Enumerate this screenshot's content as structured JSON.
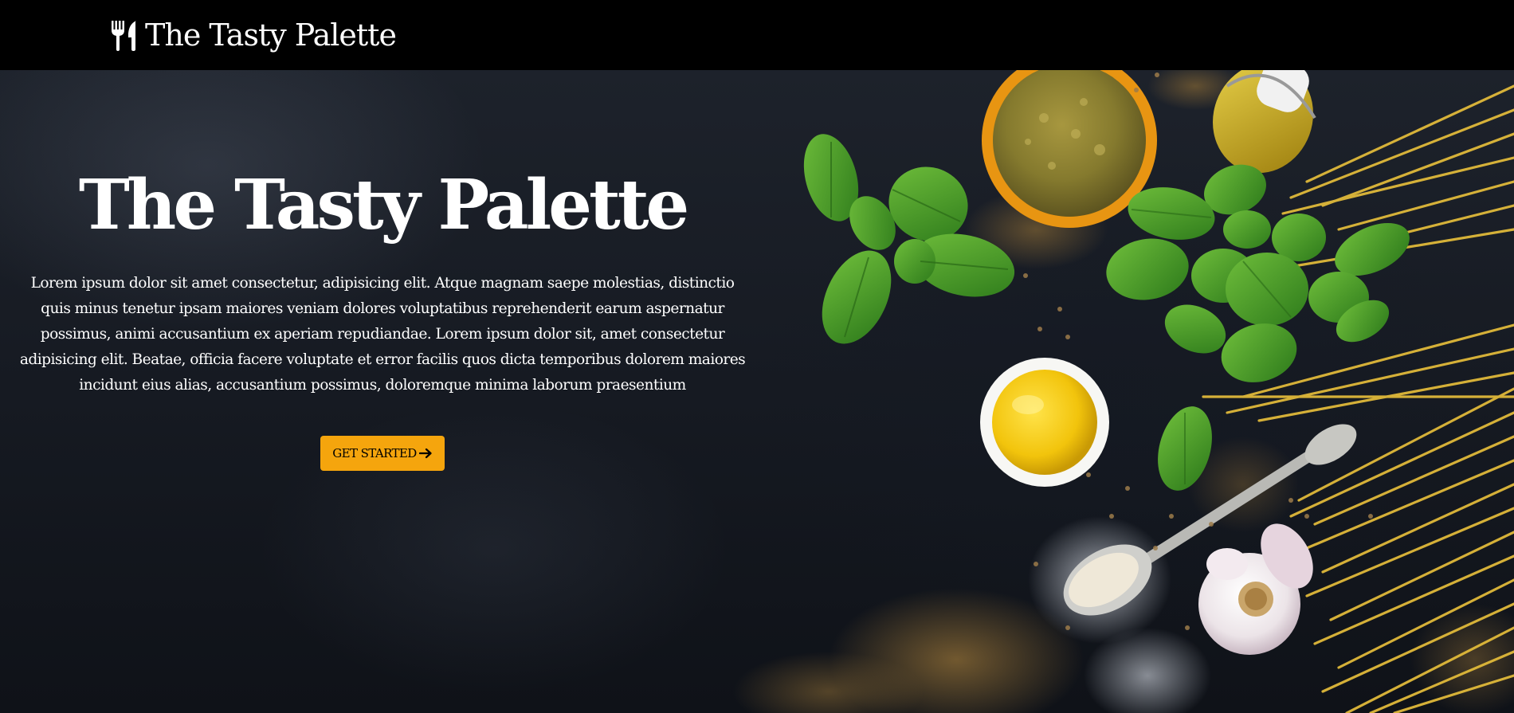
{
  "navbar": {
    "brand_icon": "utensils-icon",
    "brand_name": "The Tasty Palette"
  },
  "hero": {
    "title": "The Tasty Palette",
    "text": "Lorem ipsum dolor sit amet consectetur, adipisicing elit. Atque magnam saepe molestias, distinctio quis minus tenetur ipsam maiores veniam dolores voluptatibus reprehenderit earum aspernatur possimus, animi accusantium ex aperiam repudiandae. Lorem ipsum dolor sit, amet consectetur adipisicing elit. Beatae, officia facere voluptate et error facilis quos dicta temporibus dolorem maiores incidunt eius alias, accusantium possimus, doloremque minima laborum praesentium",
    "cta_label": "GET STARTED",
    "cta_icon": "arrow-right-icon",
    "background_image": "pesto-basil-olive-oil-spaghetti-image"
  },
  "colors": {
    "navbar_bg": "#000000",
    "cta_bg": "#f5a50d",
    "text": "#ffffff"
  }
}
